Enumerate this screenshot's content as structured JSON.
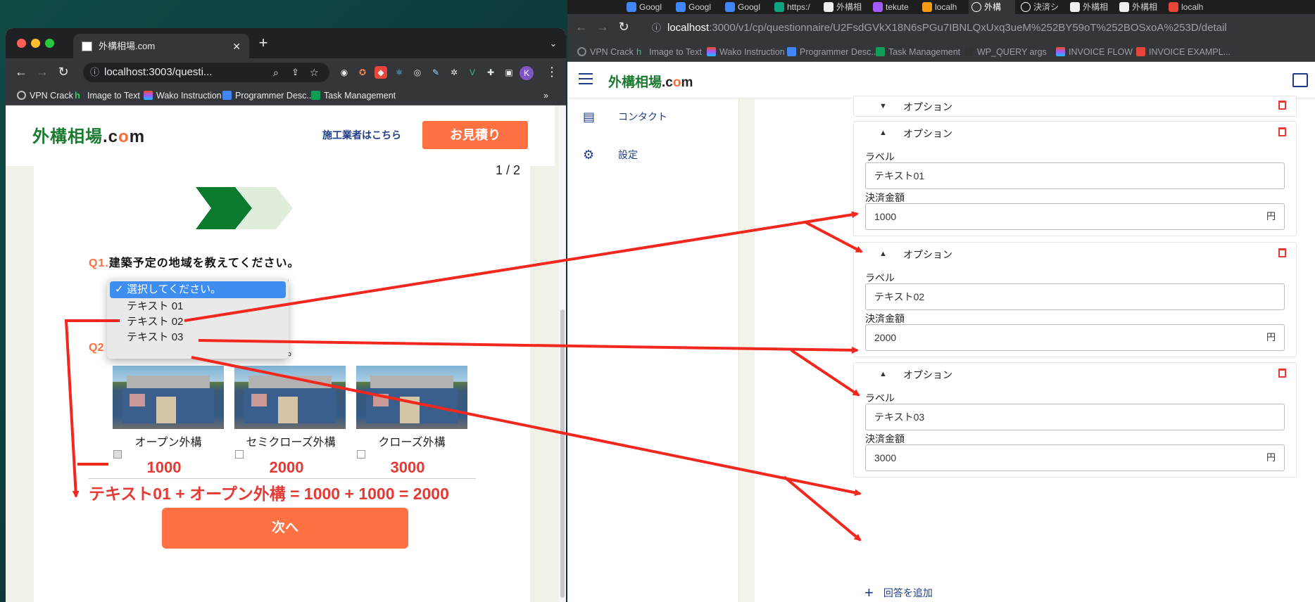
{
  "left_browser": {
    "tab_title": "外構相場.com",
    "url": "localhost:3003/questi...",
    "avatar": "K",
    "bookmarks": [
      "VPN Crack",
      "Image to Text",
      "Wako Instruction",
      "Programmer Desc...",
      "Task Management"
    ],
    "more": "»"
  },
  "left_page": {
    "logo_main": "外構相場",
    "logo_dot": ".",
    "logo_c": "c",
    "logo_o": "o",
    "logo_m": "m",
    "contractor_link": "施工業者はこちら",
    "estimate_button": "お見積り",
    "pager": "1 / 2",
    "q1_num": "Q1.",
    "q1_text": "建築予定の地域を教えてください。",
    "dropdown": {
      "options": [
        {
          "label": "選択してください。",
          "selected": true
        },
        {
          "label": "テキスト 01",
          "selected": false
        },
        {
          "label": "テキスト 02",
          "selected": false
        },
        {
          "label": "テキスト 03",
          "selected": false
        }
      ],
      "check_icon": "✓"
    },
    "q2_num": "Q2",
    "q2_tail": "。",
    "choices": [
      {
        "label": "オープン外構",
        "price": "1000"
      },
      {
        "label": "セミクローズ外構",
        "price": "2000"
      },
      {
        "label": "クローズ外構",
        "price": "3000"
      }
    ],
    "formula": "テキスト01 +  オープン外構 = 1000 + 1000 = 2000",
    "next_button": "次へ"
  },
  "right_browser": {
    "tabs": [
      "Googl",
      "Googl",
      "Googl",
      "https:/",
      "外構相",
      "tekute",
      "localh",
      "外構",
      "決済シ",
      "外構相",
      "外構相",
      "localh"
    ],
    "url_host": "localhost",
    "url_path": ":3000/v1/cp/questionnaire/U2FsdGVkX18N6sPGu7IBNLQxUxq3ueM%252BY59oT%252BOSxoA%253D/detail",
    "bookmarks": [
      "VPN Crack",
      "Image to Text",
      "Wako Instruction",
      "Programmer Desc...",
      "Task Management",
      "WP_QUERY args",
      "INVOICE FLOW",
      "INVOICE EXAMPL..."
    ]
  },
  "admin": {
    "logo_main": "外構相場",
    "logo_dot": ".",
    "logo_c": "c",
    "logo_o": "o",
    "logo_m": "m",
    "sidebar": [
      {
        "label": "コンタクト",
        "icon": "contact-book-icon"
      },
      {
        "label": "設定",
        "icon": "gear-icon"
      }
    ],
    "option_title": "オプション",
    "label_field": "ラベル",
    "amount_field": "決済金額",
    "unit": "円",
    "options": [
      {
        "collapsed": true
      },
      {
        "collapsed": false,
        "label_value": "テキスト01",
        "amount_value": "1000"
      },
      {
        "collapsed": false,
        "label_value": "テキスト02",
        "amount_value": "2000"
      },
      {
        "collapsed": false,
        "label_value": "テキスト03",
        "amount_value": "3000"
      }
    ],
    "add_answer": "回答を追加",
    "add_icon": "+"
  },
  "colors": {
    "brand_green": "#1a7a30",
    "brand_orange": "#ff7043",
    "navy": "#1f3c88",
    "annotation_red": "#e53935"
  }
}
